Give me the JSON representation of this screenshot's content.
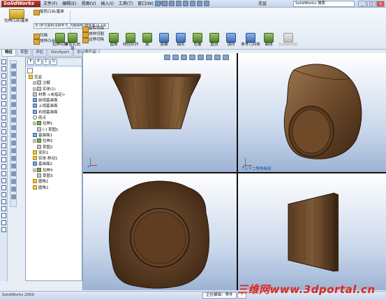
{
  "app": {
    "logo": "SolidWorks",
    "menus": [
      "文件(F)",
      "编辑(E)",
      "视图(V)",
      "插入(I)",
      "工具(T)",
      "窗口(W)",
      "帮助(H)"
    ],
    "doc_title": "花盆",
    "search_placeholder": "SolidWorks 搜索",
    "window_buttons": [
      "_",
      "□",
      "×"
    ]
  },
  "command_manager": {
    "extrude_boss": "拉伸凸台/基体",
    "col1": [
      "旋转凸台/基体",
      "扫描",
      "放样凸台/基体"
    ],
    "path": "E:\\学习资料\\SW学习_内部资料\\四件体 区 lvb",
    "col2_btns": [
      "拉伸切除",
      "异型孔向导",
      "旋转切除"
    ],
    "col3": [
      "旋转切除",
      "放样切割",
      "边界切除"
    ],
    "buttons": [
      {
        "label": "圆角",
        "style": "green"
      },
      {
        "label": "线性阵列",
        "style": "green"
      },
      {
        "label": "筋",
        "style": "green"
      },
      {
        "label": "拔模",
        "style": "blue"
      },
      {
        "label": "抽壳",
        "style": "blue"
      },
      {
        "label": "包覆",
        "style": "green"
      },
      {
        "label": "圆顶",
        "style": "green"
      },
      {
        "label": "镜向",
        "style": "blue"
      },
      {
        "label": "参考几何体",
        "style": "blue"
      },
      {
        "label": "曲线",
        "style": "green"
      },
      {
        "label": "Instant3D",
        "style": "grey"
      }
    ],
    "tabs": [
      "特征",
      "草图",
      "评估",
      "DimXpert",
      "办公室产品"
    ],
    "active_tab": "特征"
  },
  "feature_tree": {
    "tabs": [
      "F",
      "P",
      "C",
      "D"
    ],
    "items": [
      {
        "label": "花盆",
        "icon": "part-icon",
        "indent": 0
      },
      {
        "label": "注解",
        "icon": "annotation-icon",
        "indent": 1
      },
      {
        "label": "实体(1)",
        "icon": "solid-body-icon",
        "indent": 1
      },
      {
        "label": "材质 <未指定>",
        "icon": "material-icon",
        "indent": 1
      },
      {
        "label": "前视基准面",
        "icon": "plane-icon",
        "indent": 1
      },
      {
        "label": "上视基准面",
        "icon": "plane-icon",
        "indent": 1
      },
      {
        "label": "右视基准面",
        "icon": "plane-icon",
        "indent": 1
      },
      {
        "label": "原点",
        "icon": "origin-icon",
        "indent": 1
      },
      {
        "label": "拉伸1",
        "icon": "extrude-icon",
        "indent": 1
      },
      {
        "label": "(-) 草图1",
        "icon": "sketch-icon",
        "indent": 2
      },
      {
        "label": "基准面1",
        "icon": "plane-icon",
        "indent": 1
      },
      {
        "label": "拉伸2",
        "icon": "extrude-icon",
        "indent": 1
      },
      {
        "label": "草图2",
        "icon": "sketch-icon",
        "indent": 2
      },
      {
        "label": "变形1",
        "icon": "flex-icon",
        "indent": 1
      },
      {
        "label": "实体-移动1",
        "icon": "move-body-icon",
        "indent": 1
      },
      {
        "label": "基准面2",
        "icon": "plane-icon",
        "indent": 1
      },
      {
        "label": "拉伸3",
        "icon": "extrude-icon",
        "indent": 1
      },
      {
        "label": "草图3",
        "icon": "sketch-icon",
        "indent": 2
      },
      {
        "label": "圆角1",
        "icon": "fillet-icon",
        "indent": 1
      },
      {
        "label": "圆角2",
        "icon": "fillet-icon",
        "indent": 1
      }
    ]
  },
  "viewport": {
    "view_label_iso": "*上下二等角轴测"
  },
  "status": {
    "app_version": "SolidWorks 2009",
    "mode": "正在编辑：零件",
    "units": "?"
  },
  "watermark": "三维网www.3dportal.cn",
  "colors": {
    "wood_dark": "#3e2614",
    "wood_mid": "#6d4a2b",
    "wood_light": "#9b7651"
  }
}
